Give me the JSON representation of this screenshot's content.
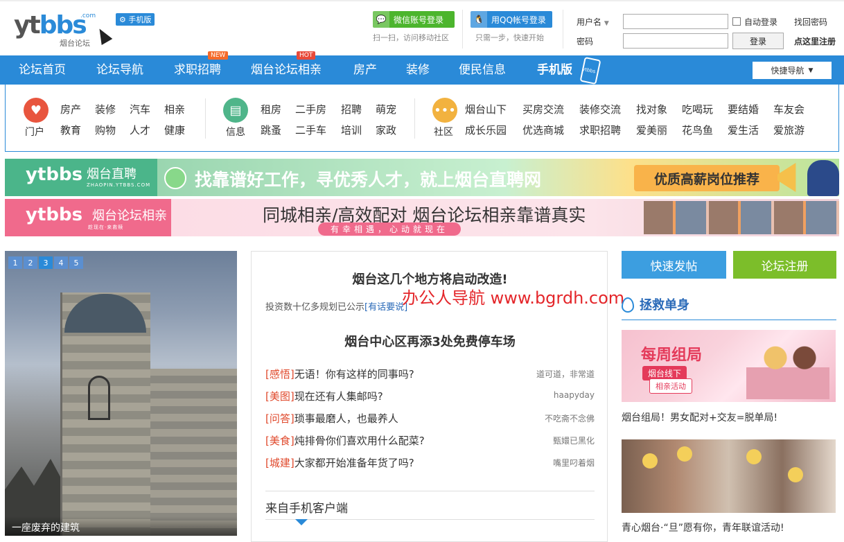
{
  "header": {
    "logo_main_a": "yt",
    "logo_main_b": "bbs",
    "logo_sub": "烟台论坛",
    "logo_dotcom": ".com",
    "mobile_tag": "手机版",
    "wechat_login": "微信账号登录",
    "wechat_sub": "扫一扫，访问移动社区",
    "qq_login": "用QQ帐号登录",
    "qq_sub": "只需一步，快速开始",
    "username_label": "用户名",
    "password_label": "密码",
    "auto_login": "自动登录",
    "login_button": "登录",
    "find_password": "找回密码",
    "register_link": "点这里注册"
  },
  "nav": {
    "items": [
      {
        "label": "论坛首页"
      },
      {
        "label": "论坛导航"
      },
      {
        "label": "求职招聘",
        "badge": "NEW"
      },
      {
        "label": "烟台论坛相亲",
        "badge": "HOT"
      },
      {
        "label": "房产"
      },
      {
        "label": "装修"
      },
      {
        "label": "便民信息"
      },
      {
        "label": "手机版"
      }
    ],
    "phone_text": "ytbbs",
    "quick_nav": "快捷导航"
  },
  "categories": [
    {
      "title": "门户",
      "icon": "heart-icon",
      "color": "#e8553e",
      "row1": [
        "房产",
        "装修",
        "汽车",
        "相亲"
      ],
      "row2": [
        "教育",
        "购物",
        "人才",
        "健康"
      ]
    },
    {
      "title": "信息",
      "icon": "document-icon",
      "color": "#4fb58a",
      "row1": [
        "租房",
        "二手房",
        "招聘",
        "萌宠"
      ],
      "row2": [
        "跳蚤",
        "二手车",
        "培训",
        "家政"
      ]
    },
    {
      "title": "社区",
      "icon": "chat-icon",
      "color": "#f2b23f",
      "row1": [
        "烟台山下",
        "买房交流",
        "装修交流",
        "找对象",
        "吃喝玩",
        "要结婚",
        "车友会"
      ],
      "row2": [
        "成长乐园",
        "优选商城",
        "求职招聘",
        "爱美丽",
        "花鸟鱼",
        "爱生活",
        "爱旅游"
      ]
    }
  ],
  "banner1": {
    "logo": "ytbbs",
    "sub": "烟台直聘",
    "tiny": "ZHAOPIN.YTBBS.COM",
    "slogan": "找靠谱好工作，寻优秀人才，就上烟台直聘网",
    "tag": "优质高薪岗位推荐"
  },
  "banner2": {
    "logo": "ytbbs",
    "sub": "烟台论坛相亲",
    "tiny": "趁现在·来救赎",
    "slogan": "同城相亲/高效配对  烟台论坛相亲靠谱真实",
    "slogan_sub": "有幸相遇，心动就现在"
  },
  "slider": {
    "pages": [
      "1",
      "2",
      "3",
      "4",
      "5"
    ],
    "active_page": 3,
    "caption": "一座废弃的建筑"
  },
  "middle": {
    "headline1": "烟台这几个地方将启动改造!",
    "summary": "投资数十亿多规划已公示",
    "summary_link": "[有话要说]",
    "headline2": "烟台中心区再添3处免费停车场",
    "watermark": "办公人导航 www.bgrdh.com",
    "news": [
      {
        "tag": "[感悟]",
        "title": "无语！你有这样的同事吗?",
        "author": "道可道，非常道"
      },
      {
        "tag": "[美图]",
        "title": "现在还有人集邮吗?",
        "author": "haapyday"
      },
      {
        "tag": "[问答]",
        "title": "琐事最磨人，也最养人",
        "author": "不吃斋不念佛"
      },
      {
        "tag": "[美食]",
        "title": "炖排骨你们喜欢用什么配菜?",
        "author": "甄嬛已黑化"
      },
      {
        "tag": "[城建]",
        "title": "大家都开始准备年货了吗?",
        "author": "嘴里叼着烟"
      }
    ],
    "mobile_client": "来自手机客户端"
  },
  "right": {
    "quick_post": "快速发帖",
    "register": "论坛注册",
    "section_title": "拯救单身",
    "card1_title": "每周组局",
    "card1_tag": "烟台线下",
    "card1_tag2": "相亲活动",
    "card1_caption": "烟台组局！男女配对+交友=脱单局!",
    "card2_caption": "青心烟台·“旦”愿有你，青年联谊活动!"
  }
}
